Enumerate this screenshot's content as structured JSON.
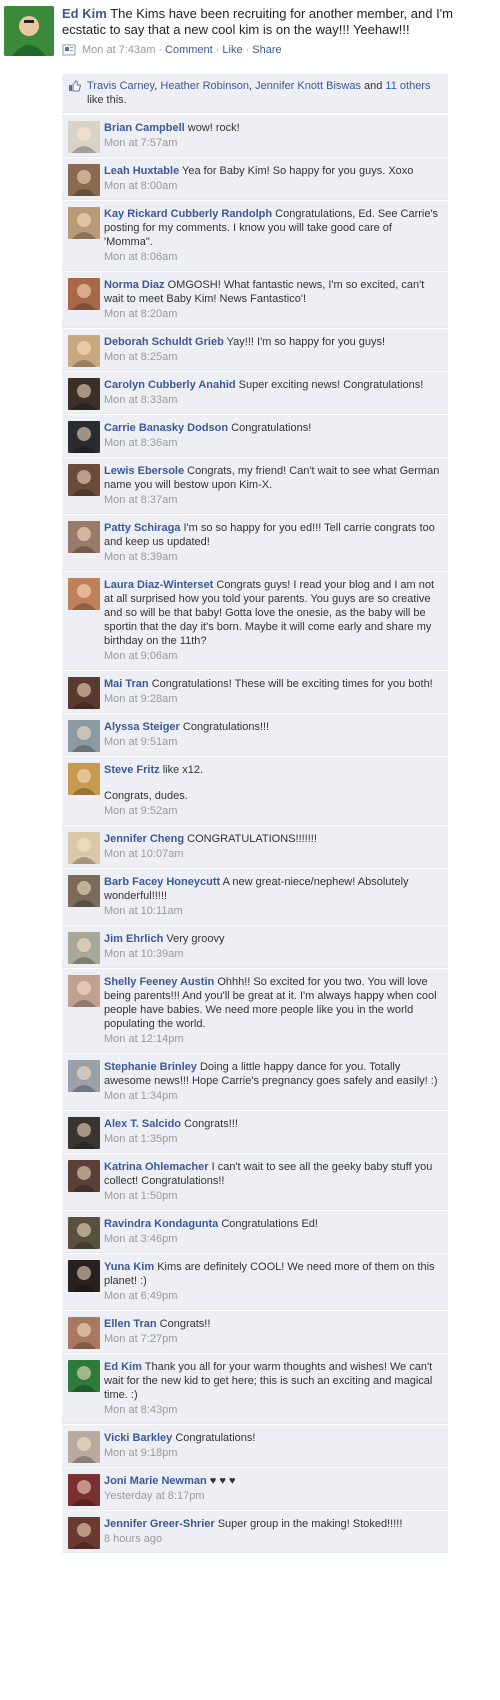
{
  "post": {
    "author": "Ed Kim",
    "text": "The Kims have been recruiting for another member, and I'm ecstatic to say that a new cool kim is on the way!!! Yeehaw!!!",
    "time": "Mon at 7:43am",
    "comment_link": "Comment",
    "like_link": "Like",
    "share_link": "Share",
    "separator": "·"
  },
  "likes": {
    "names": [
      "Travis Carney",
      "Heather Robinson",
      "Jennifer Knott Biswas"
    ],
    "name_sep": ", ",
    "and_text": " and ",
    "others": "11 others",
    "suffix": " like this."
  },
  "comments": [
    {
      "name": "Brian Campbell",
      "text": "wow! rock!",
      "time": "Mon at 7:57am",
      "color": "#d9d2c8"
    },
    {
      "name": "Leah Huxtable",
      "text": "Yea for Baby Kim! So happy for you guys. Xoxo",
      "time": "Mon at 8:00am",
      "color": "#8a6a52"
    },
    {
      "name": "Kay Rickard Cubberly Randolph",
      "text": "Congratulations, Ed. See Carrie's posting for my comments. I know you will take good care of 'Momma\".",
      "time": "Mon at 8:06am",
      "color": "#b99a76"
    },
    {
      "name": "Norma Diaz",
      "text": "OMGOSH! What fantastic news, I'm so excited, can't wait to meet Baby Kim! News Fantastico'!",
      "time": "Mon at 8:20am",
      "color": "#a86848"
    },
    {
      "name": "Deborah Schuldt Grieb",
      "text": "Yay!!! I'm so happy for you guys!",
      "time": "Mon at 8:25am",
      "color": "#c8a880"
    },
    {
      "name": "Carolyn Cubberly Anahid",
      "text": "Super exciting news! Congratulations!",
      "time": "Mon at 8:33am",
      "color": "#3a3028"
    },
    {
      "name": "Carrie Banasky Dodson",
      "text": "Congratulations!",
      "time": "Mon at 8:36am",
      "color": "#2a2a30"
    },
    {
      "name": "Lewis Ebersole",
      "text": "Congrats, my friend! Can't wait to see what German name you will bestow upon Kim-X.",
      "time": "Mon at 8:37am",
      "color": "#6a4a3a"
    },
    {
      "name": "Patty Schiraga",
      "text": "I'm so so happy for you ed!!! Tell carrie congrats too and keep us updated!",
      "time": "Mon at 8:39am",
      "color": "#9a7a6a"
    },
    {
      "name": "Laura Diaz-Winterset",
      "text": "Congrats guys! I read your blog and I am not at all surprised how you told your parents. You guys are so creative and so will be that baby! Gotta love the onesie, as the baby will be sportin that the day it's born. Maybe it will come early and share my birthday on the 11th?",
      "time": "Mon at 9:06am",
      "color": "#c0805a"
    },
    {
      "name": "Mai Tran",
      "text": "Congratulations! These will be exciting times for you both!",
      "time": "Mon at 9:28am",
      "color": "#5a3a30"
    },
    {
      "name": "Alyssa Steiger",
      "text": "Congratulations!!!",
      "time": "Mon at 9:51am",
      "color": "#8a9aa0"
    },
    {
      "name": "Steve Fritz",
      "text": "like x12.",
      "extra": "Congrats, dudes.",
      "time": "Mon at 9:52am",
      "color": "#c89a50"
    },
    {
      "name": "Jennifer Cheng",
      "text": "CONGRATULATIONS!!!!!!!",
      "time": "Mon at 10:07am",
      "color": "#d8c8a8"
    },
    {
      "name": "Barb Facey Honeycutt",
      "text": "A new great-niece/nephew! Absolutely wonderful!!!!!",
      "time": "Mon at 10:11am",
      "color": "#7a6a5a"
    },
    {
      "name": "Jim Ehrlich",
      "text": "Very groovy",
      "time": "Mon at 10:39am",
      "color": "#a8a898"
    },
    {
      "name": "Shelly Feeney Austin",
      "text": "Ohhh!! So excited for you two. You will love being parents!!! And you'll be great at it. I'm always happy when cool people have babies. We need more people like you in the world populating the world.",
      "time": "Mon at 12:14pm",
      "color": "#c0a090"
    },
    {
      "name": "Stephanie Brinley",
      "text": "Doing a little happy dance for you. Totally awesome news!!! Hope Carrie's pregnancy goes safely and easily! :)",
      "time": "Mon at 1:34pm",
      "color": "#9aa0a8"
    },
    {
      "name": "Alex T. Salcido",
      "text": "Congrats!!!",
      "time": "Mon at 1:35pm",
      "color": "#3a3430"
    },
    {
      "name": "Katrina Ohlemacher",
      "text": "I can't wait to see all the geeky baby stuff you collect! Congratulations!!",
      "time": "Mon at 1:50pm",
      "color": "#5a4038"
    },
    {
      "name": "Ravindra Kondagunta",
      "text": "Congratulations Ed!",
      "time": "Mon at 3:46pm",
      "color": "#5a5040"
    },
    {
      "name": "Yuna Kim",
      "text": "Kims are definitely COOL! We need more of them on this planet! :)",
      "time": "Mon at 6:49pm",
      "color": "#2a2020"
    },
    {
      "name": "Ellen Tran",
      "text": "Congrats!!",
      "time": "Mon at 7:27pm",
      "color": "#a87860"
    },
    {
      "name": "Ed Kim",
      "text": "Thank you all for your warm thoughts and wishes! We can't wait for the new kid to get here; this is such an exciting and magical time. :)",
      "time": "Mon at 8:43pm",
      "color": "#2d7a3a"
    },
    {
      "name": "Vicki Barkley",
      "text": "Congratulations!",
      "time": "Mon at 9:18pm",
      "color": "#b8aaa0"
    },
    {
      "name": "Joni Marie Newman",
      "text": "♥ ♥ ♥",
      "time": "Yesterday at 8:17pm",
      "color": "#7a3030"
    },
    {
      "name": "Jennifer Greer-Shrier",
      "text": "Super group in the making! Stoked!!!!!",
      "time": "8 hours ago",
      "color": "#6a3a30"
    }
  ]
}
